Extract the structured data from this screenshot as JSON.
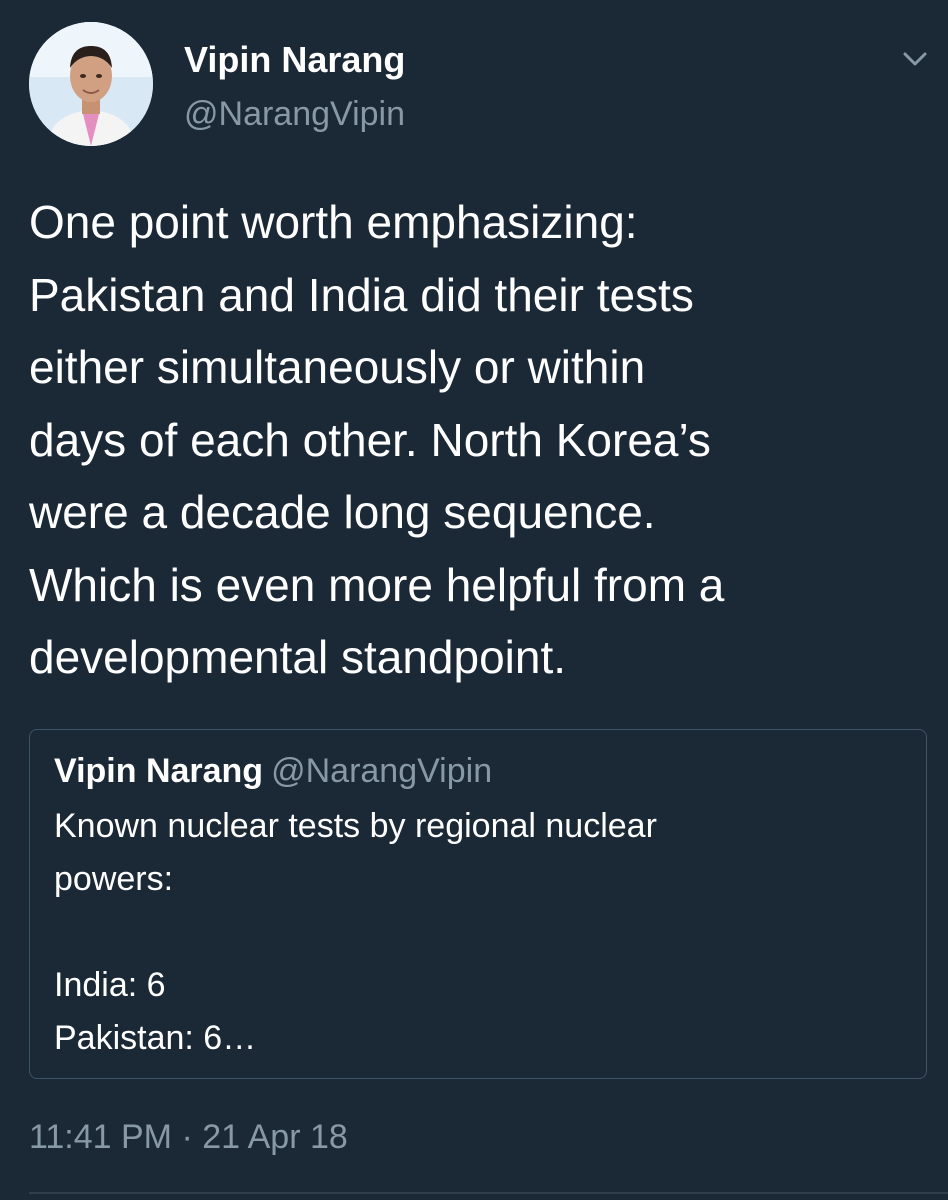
{
  "tweet": {
    "author_name": "Vipin Narang",
    "author_handle": "@NarangVipin",
    "text_lines": [
      "One point worth emphasizing:",
      "Pakistan and India did their tests",
      "either simultaneously or within",
      "days of each other. North Korea’s",
      "were a decade long sequence.",
      "Which is even more helpful from a",
      "developmental standpoint."
    ],
    "timestamp": "11:41 PM · 21 Apr 18"
  },
  "quoted_tweet": {
    "author_name": "Vipin Narang",
    "author_handle": "@NarangVipin",
    "text_lines": [
      "Known nuclear tests by regional nuclear",
      "powers:",
      "",
      "India: 6",
      "Pakistan: 6…"
    ]
  },
  "icons": {
    "menu": "chevron-down-icon",
    "avatar": "avatar"
  },
  "colors": {
    "background": "#1b2836",
    "primary_text": "#ffffff",
    "secondary_text": "#8899a6",
    "border": "#3d5466"
  }
}
